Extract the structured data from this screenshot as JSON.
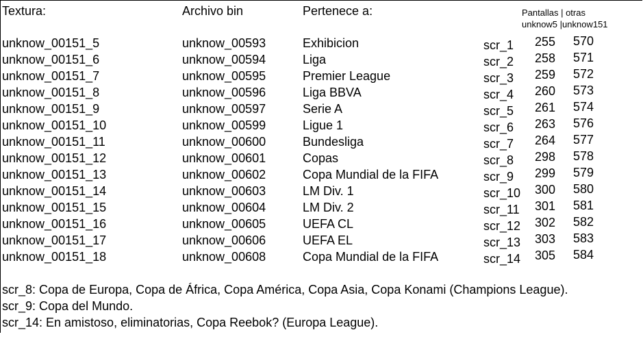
{
  "headers": {
    "textura": "Textura:",
    "archivo_bin": "Archivo bin",
    "pertenece": "Pertenece a:",
    "pantallas_line1": "Pantallas | otras",
    "pantallas_line2": "unknow5 |unknow151"
  },
  "rows": [
    {
      "textura": "unknow_00151_5",
      "bin": "unknow_00593",
      "pertenece": "Exhibicion",
      "scr": "scr_1",
      "p": "255",
      "o": "570"
    },
    {
      "textura": "unknow_00151_6",
      "bin": "unknow_00594",
      "pertenece": "Liga",
      "scr": "scr_2",
      "p": "258",
      "o": "571"
    },
    {
      "textura": "unknow_00151_7",
      "bin": "unknow_00595",
      "pertenece": "Premier League",
      "scr": "scr_3",
      "p": "259",
      "o": "572"
    },
    {
      "textura": "unknow_00151_8",
      "bin": "unknow_00596",
      "pertenece": "Liga BBVA",
      "scr": "scr_4",
      "p": "260",
      "o": "573"
    },
    {
      "textura": "unknow_00151_9",
      "bin": "unknow_00597",
      "pertenece": "Serie A",
      "scr": "scr_5",
      "p": "261",
      "o": "574"
    },
    {
      "textura": "unknow_00151_10",
      "bin": "unknow_00599",
      "pertenece": "Ligue 1",
      "scr": "scr_6",
      "p": "263",
      "o": "576"
    },
    {
      "textura": "unknow_00151_11",
      "bin": "unknow_00600",
      "pertenece": "Bundesliga",
      "scr": "scr_7",
      "p": "264",
      "o": "577"
    },
    {
      "textura": "unknow_00151_12",
      "bin": "unknow_00601",
      "pertenece": "Copas",
      "scr": "scr_8",
      "p": "298",
      "o": "578"
    },
    {
      "textura": "unknow_00151_13",
      "bin": "unknow_00602",
      "pertenece": "Copa Mundial de la FIFA",
      "scr": "scr_9",
      "p": "299",
      "o": "579"
    },
    {
      "textura": "unknow_00151_14",
      "bin": "unknow_00603",
      "pertenece": "LM Div. 1",
      "scr": "scr_10",
      "p": "300",
      "o": "580"
    },
    {
      "textura": "unknow_00151_15",
      "bin": "unknow_00604",
      "pertenece": "LM Div. 2",
      "scr": "scr_11",
      "p": "301",
      "o": "581"
    },
    {
      "textura": "unknow_00151_16",
      "bin": "unknow_00605",
      "pertenece": "UEFA CL",
      "scr": "scr_12",
      "p": "302",
      "o": "582"
    },
    {
      "textura": "unknow_00151_17",
      "bin": "unknow_00606",
      "pertenece": "UEFA EL",
      "scr": "scr_13",
      "p": "303",
      "o": "583"
    },
    {
      "textura": "unknow_00151_18",
      "bin": "unknow_00608",
      "pertenece": "Copa Mundial de la FIFA",
      "scr": "scr_14",
      "p": "305",
      "o": "584"
    }
  ],
  "notes": [
    "scr_8: Copa de Europa, Copa de África, Copa América, Copa Asia, Copa Konami (Champions League).",
    "scr_9: Copa del Mundo.",
    "scr_14: En amistoso, eliminatorias, Copa Reebok? (Europa League)."
  ]
}
